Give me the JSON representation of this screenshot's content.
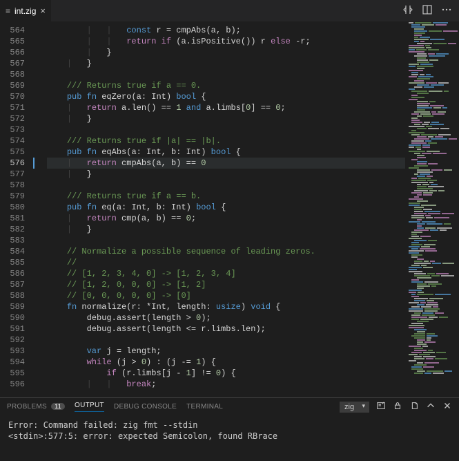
{
  "tab": {
    "filename": "int.zig"
  },
  "gutter_start": 564,
  "gutter_count": 33,
  "active_line": 576,
  "code_lines": [
    [
      [
        "",
        "        "
      ],
      [
        "indent",
        "|   |   "
      ],
      [
        "kw",
        "const"
      ],
      [
        "",
        " r = cmpAbs(a, b);"
      ]
    ],
    [
      [
        "",
        "        "
      ],
      [
        "indent",
        "|   |   "
      ],
      [
        "kw-return",
        "return "
      ],
      [
        "kw-return",
        "if"
      ],
      [
        "",
        " (a.isPositive()) r "
      ],
      [
        "kw-return",
        "else"
      ],
      [
        "",
        " -r;"
      ]
    ],
    [
      [
        "",
        "        "
      ],
      [
        "indent",
        "|   "
      ],
      [
        "",
        "}"
      ]
    ],
    [
      [
        "",
        "    "
      ],
      [
        "indent",
        "|   "
      ],
      [
        "",
        "}"
      ]
    ],
    [
      [
        "",
        ""
      ]
    ],
    [
      [
        "",
        "    "
      ],
      [
        "comment",
        "/// Returns true if a == 0."
      ]
    ],
    [
      [
        "",
        "    "
      ],
      [
        "kw",
        "pub "
      ],
      [
        "kw",
        "fn"
      ],
      [
        "",
        " eqZero(a: Int) "
      ],
      [
        "kw",
        "bool"
      ],
      [
        "",
        " {"
      ]
    ],
    [
      [
        "",
        "    "
      ],
      [
        "indent",
        "|   "
      ],
      [
        "kw-return",
        "return"
      ],
      [
        "",
        " a.len() == "
      ],
      [
        "num",
        "1"
      ],
      [
        "",
        " "
      ],
      [
        "kw",
        "and"
      ],
      [
        "",
        " a.limbs["
      ],
      [
        "num",
        "0"
      ],
      [
        "",
        ""
      ],
      [
        "",
        "] == "
      ],
      [
        "num",
        "0"
      ],
      [
        "",
        ";"
      ]
    ],
    [
      [
        "",
        "    "
      ],
      [
        "indent",
        "|   "
      ],
      [
        "",
        "}"
      ]
    ],
    [
      [
        "",
        ""
      ]
    ],
    [
      [
        "",
        "    "
      ],
      [
        "comment",
        "/// Returns true if |a| == |b|."
      ]
    ],
    [
      [
        "",
        "    "
      ],
      [
        "kw",
        "pub "
      ],
      [
        "kw",
        "fn"
      ],
      [
        "",
        " eqAbs(a: Int, b: Int) "
      ],
      [
        "kw",
        "bool"
      ],
      [
        "",
        " {"
      ]
    ],
    [
      [
        "",
        "    "
      ],
      [
        "indent",
        "|   "
      ],
      [
        "kw-return",
        "return"
      ],
      [
        "",
        " cmpAbs(a, b) == "
      ],
      [
        "num",
        "0"
      ]
    ],
    [
      [
        "",
        "    "
      ],
      [
        "indent",
        "|   "
      ],
      [
        "",
        "}"
      ]
    ],
    [
      [
        "",
        ""
      ]
    ],
    [
      [
        "",
        "    "
      ],
      [
        "comment",
        "/// Returns true if a == b."
      ]
    ],
    [
      [
        "",
        "    "
      ],
      [
        "kw",
        "pub "
      ],
      [
        "kw",
        "fn"
      ],
      [
        "",
        " eq(a: Int, b: Int) "
      ],
      [
        "kw",
        "bool"
      ],
      [
        "",
        " {"
      ]
    ],
    [
      [
        "",
        "    "
      ],
      [
        "indent",
        "|   "
      ],
      [
        "kw-return",
        "return"
      ],
      [
        "",
        " cmp(a, b) == "
      ],
      [
        "num",
        "0"
      ],
      [
        "",
        ";"
      ]
    ],
    [
      [
        "",
        "    "
      ],
      [
        "indent",
        "|   "
      ],
      [
        "",
        "}"
      ]
    ],
    [
      [
        "",
        ""
      ]
    ],
    [
      [
        "",
        "    "
      ],
      [
        "comment",
        "// Normalize a possible sequence of leading zeros."
      ]
    ],
    [
      [
        "",
        "    "
      ],
      [
        "comment",
        "//"
      ]
    ],
    [
      [
        "",
        "    "
      ],
      [
        "comment",
        "// [1, 2, 3, 4, 0] -> [1, 2, 3, 4]"
      ]
    ],
    [
      [
        "",
        "    "
      ],
      [
        "comment",
        "// [1, 2, 0, 0, 0] -> [1, 2]"
      ]
    ],
    [
      [
        "",
        "    "
      ],
      [
        "comment",
        "// [0, 0, 0, 0, 0] -> [0]"
      ]
    ],
    [
      [
        "",
        "    "
      ],
      [
        "kw",
        "fn"
      ],
      [
        "",
        " normalize(r: *Int, length: "
      ],
      [
        "type",
        "usize"
      ],
      [
        "",
        ") "
      ],
      [
        "kw",
        "void"
      ],
      [
        "",
        " {"
      ]
    ],
    [
      [
        "",
        "        debug.assert(length > "
      ],
      [
        "num",
        "0"
      ],
      [
        "",
        ");"
      ]
    ],
    [
      [
        "",
        "        debug.assert(length <= r.limbs.len);"
      ]
    ],
    [
      [
        "",
        ""
      ]
    ],
    [
      [
        "",
        "        "
      ],
      [
        "kw",
        "var"
      ],
      [
        "",
        " j = length;"
      ]
    ],
    [
      [
        "",
        "        "
      ],
      [
        "kw-return",
        "while"
      ],
      [
        "",
        " (j > "
      ],
      [
        "num",
        "0"
      ],
      [
        "",
        ") : (j -= "
      ],
      [
        "num",
        "1"
      ],
      [
        "",
        ") {"
      ]
    ],
    [
      [
        "",
        "            "
      ],
      [
        "kw-return",
        "if"
      ],
      [
        "",
        " (r.limbs[j - "
      ],
      [
        "num",
        "1"
      ],
      [
        "",
        "] != "
      ],
      [
        "num",
        "0"
      ],
      [
        "",
        ") {"
      ]
    ],
    [
      [
        "",
        "        "
      ],
      [
        "indent",
        "|   |   "
      ],
      [
        "kw-return",
        "break"
      ],
      [
        "",
        ";"
      ]
    ]
  ],
  "panel": {
    "tabs": {
      "problems": "PROBLEMS",
      "problems_count": "11",
      "output": "OUTPUT",
      "debug": "DEBUG CONSOLE",
      "terminal": "TERMINAL"
    },
    "language": "zig"
  },
  "output": {
    "line1": "Error: Command failed: zig fmt --stdin",
    "line2": "<stdin>:577:5: error: expected Semicolon, found RBrace"
  }
}
